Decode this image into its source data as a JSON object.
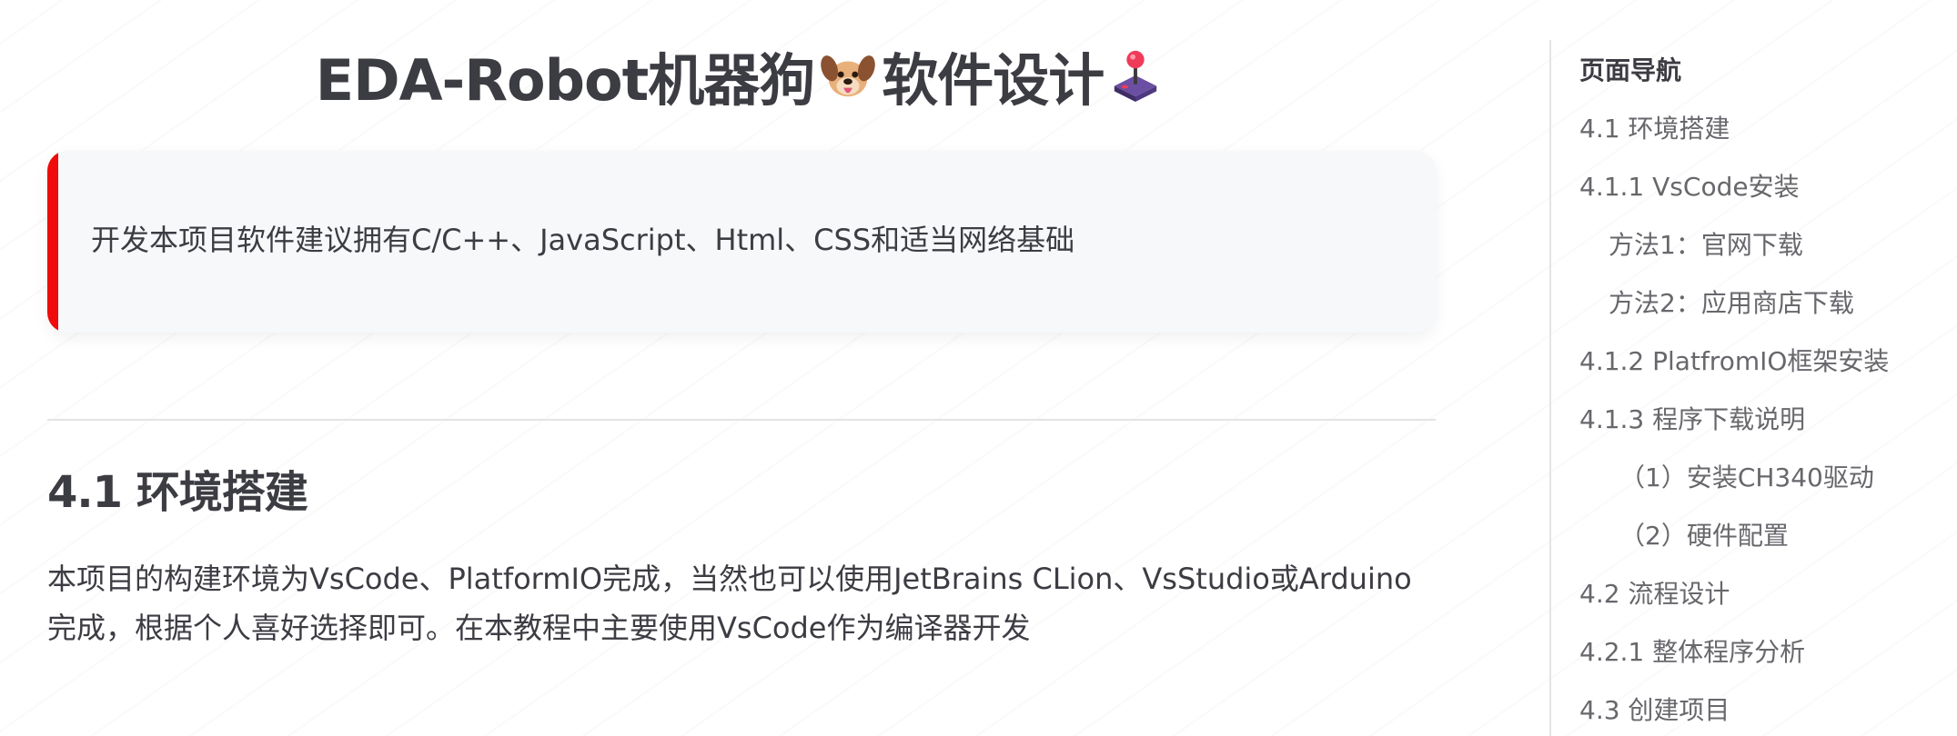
{
  "article": {
    "title": "EDA-Robot机器狗",
    "title_suffix": "软件设计",
    "title_icons": [
      "dog-face-icon",
      "joystick-icon"
    ],
    "callout": {
      "text": "开发本项目软件建议拥有C/C++、JavaScript、Html、CSS和适当网络基础",
      "accent_color": "#ef0b0b"
    },
    "section_title": "4.1 环境搭建",
    "paragraph": "本项目的构建环境为VsCode、PlatformIO完成，当然也可以使用JetBrains CLion、VsStudio或Arduino完成，根据个人喜好选择即可。在本教程中主要使用VsCode作为编译器开发"
  },
  "toc": {
    "title": "页面导航",
    "items": [
      {
        "label": "4.1 环境搭建"
      },
      {
        "label": "4.1.1 VsCode安装"
      },
      {
        "label": "方法1：官网下载"
      },
      {
        "label": "方法2：应用商店下载"
      },
      {
        "label": "4.1.2 PlatfromIO框架安装"
      },
      {
        "label": "4.1.3 程序下载说明"
      },
      {
        "label": "（1）安装CH340驱动"
      },
      {
        "label": "（2）硬件配置"
      },
      {
        "label": "4.2 流程设计"
      },
      {
        "label": "4.2.1 整体程序分析"
      },
      {
        "label": "4.3 创建项目"
      }
    ]
  }
}
